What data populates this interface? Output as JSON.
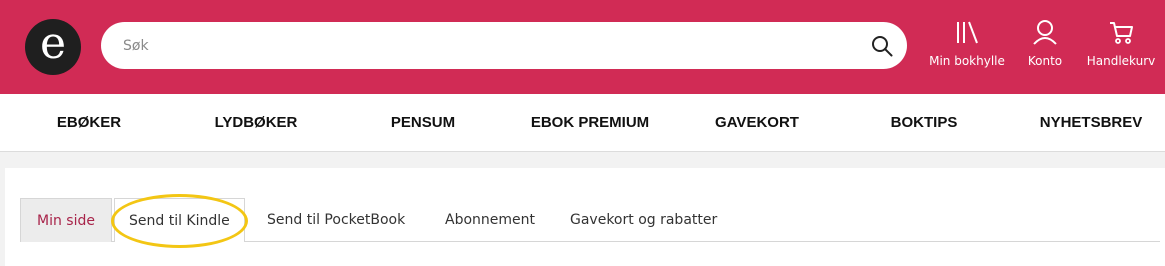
{
  "logo": {
    "letter": "e"
  },
  "search": {
    "placeholder": "Søk"
  },
  "header": {
    "shelf_label": "Min bokhylle",
    "account_label": "Konto",
    "cart_label": "Handlekurv"
  },
  "nav": {
    "items": [
      "EBØKER",
      "LYDBØKER",
      "PENSUM",
      "EBOK PREMIUM",
      "GAVEKORT",
      "BOKTIPS",
      "NYHETSBREV"
    ]
  },
  "tabs": {
    "items": [
      "Min side",
      "Send til Kindle",
      "Send til PocketBook",
      "Abonnement",
      "Gavekort og rabatter"
    ],
    "active": "Min side"
  },
  "colors": {
    "brand": "#d12b55",
    "highlight": "#f3c614",
    "active_tab_text": "#a8244a"
  }
}
